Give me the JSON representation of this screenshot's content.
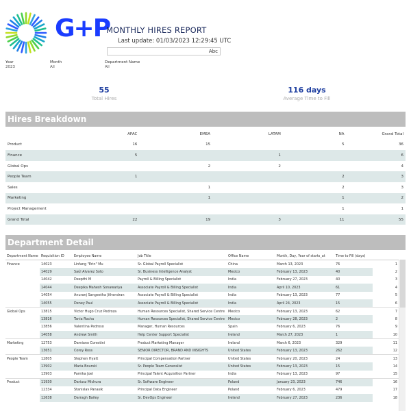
{
  "header": {
    "logo_text": "G+P",
    "title": "MONTHLY HIRES REPORT",
    "last_update": "Last update: 01/03/2023 12:29:45 UTC",
    "search_value": "Abc"
  },
  "filters": [
    {
      "label": "Year",
      "value": "2023"
    },
    {
      "label": "Month",
      "value": "All"
    },
    {
      "label": "Department Name",
      "value": "All"
    }
  ],
  "kpis": [
    {
      "value": "55",
      "caption": "Total Hires"
    },
    {
      "value": "116 days",
      "caption": "Average Time to Fill"
    }
  ],
  "breakdown": {
    "title": "Hires Breakdown",
    "columns": [
      "",
      "APAC",
      "EMEA",
      "LATAM",
      "NA",
      "Grand Total"
    ],
    "rows": [
      [
        "Product",
        "16",
        "15",
        "",
        "5",
        "36"
      ],
      [
        "Finance",
        "5",
        "",
        "1",
        "",
        "6"
      ],
      [
        "Global Ops",
        "",
        "2",
        "2",
        "",
        "4"
      ],
      [
        "People Team",
        "1",
        "",
        "",
        "2",
        "3"
      ],
      [
        "Sales",
        "",
        "1",
        "",
        "2",
        "3"
      ],
      [
        "Marketing",
        "",
        "1",
        "",
        "1",
        "2"
      ],
      [
        "Project Management",
        "",
        "",
        "",
        "1",
        "1"
      ],
      [
        "Grand Total",
        "22",
        "19",
        "3",
        "11",
        "55"
      ]
    ]
  },
  "detail": {
    "title": "Department Detail",
    "columns": [
      "Department Name",
      "Requisition ID",
      "Employee Name",
      "Job Title",
      "Office Name",
      "Month, Day, Year of starts_at",
      "Time to Fill (days)",
      ""
    ],
    "rows": [
      [
        "Finance",
        "14023",
        "Linfang \"Erin\" Mu",
        "Sr. Global Payroll Specialist",
        "China",
        "March 13, 2023",
        "76",
        "1"
      ],
      [
        "",
        "14029",
        "Saúl Alvarez Soto",
        "Sr. Business Intelligence Analyst",
        "Mexico",
        "February 13, 2023",
        "40",
        "2"
      ],
      [
        "",
        "14042",
        "Deepthi M",
        "Payroll & Billing Specialist",
        "India",
        "February 27, 2023",
        "40",
        "3"
      ],
      [
        "",
        "14044",
        "Deepika Mahesh Sonawariya",
        "Associate Payroll & Billing Specialist",
        "India",
        "April 10, 2023",
        "61",
        "4"
      ],
      [
        "",
        "14054",
        "Anuranj Sangeetha Jithendran",
        "Associate Payroll & Billing Specialist",
        "India",
        "February 13, 2023",
        "77",
        "5"
      ],
      [
        "",
        "14055",
        "Deney Paul",
        "Associate Payroll & Billing Specialist",
        "India",
        "April 24, 2023",
        "15",
        "6"
      ],
      [
        "Global Ops",
        "13815",
        "Victor Hugo Cruz Pedroza",
        "Human Resources Specialist, Shared Service Centre",
        "Mexico",
        "February 13, 2023",
        "62",
        "7"
      ],
      [
        "",
        "13816",
        "Tania Rocha",
        "Human Resources Specialist, Shared Service Centre",
        "Mexico",
        "February 28, 2023",
        "2",
        "8"
      ],
      [
        "",
        "13856",
        "Valentina Pedroso",
        "Manager, Human Resources",
        "Spain",
        "February 6, 2023",
        "76",
        "9"
      ],
      [
        "",
        "14058",
        "Andrew Smith",
        "Help Center Support Specialist",
        "Ireland",
        "March 27, 2023",
        "1",
        "10"
      ],
      [
        "Marketing",
        "12753",
        "Damiano Corestini",
        "Product Marketing Manager",
        "Ireland",
        "March 6, 2023",
        "329",
        "11"
      ],
      [
        "",
        "13651",
        "Corey Ross",
        "SENIOR DIRECTOR, BRAND AND INSIGHTS",
        "United States",
        "February 13, 2023",
        "262",
        "12"
      ],
      [
        "People Team",
        "12805",
        "Stephen Hyatt",
        "Principal Compensation Partner",
        "United States",
        "February 20, 2023",
        "24",
        "13"
      ],
      [
        "",
        "13902",
        "Maria Bourski",
        "Sr. People Team Generalist",
        "United States",
        "February 13, 2023",
        "15",
        "14"
      ],
      [
        "",
        "13903",
        "Pamika Joel",
        "Principal Talent Acquisition Partner",
        "India",
        "February 13, 2023",
        "97",
        "15"
      ],
      [
        "Product",
        "11930",
        "Dariusz Michura",
        "Sr. Software Engineer",
        "Poland",
        "January 23, 2023",
        "746",
        "16"
      ],
      [
        "",
        "12334",
        "Stanislav Panasik",
        "Principal Data Engineer",
        "Poland",
        "February 6, 2023",
        "479",
        "17"
      ],
      [
        "",
        "12638",
        "Darragh Bailey",
        "Sr. DevOps Engineer",
        "Ireland",
        "February 27, 2023",
        "236",
        "18"
      ]
    ]
  },
  "colors": {
    "brand_blue": "#1a3cff",
    "kpi_blue": "#1f3fa0",
    "banner_gray": "#bdbdbd",
    "row_band": "#dde8e8"
  }
}
